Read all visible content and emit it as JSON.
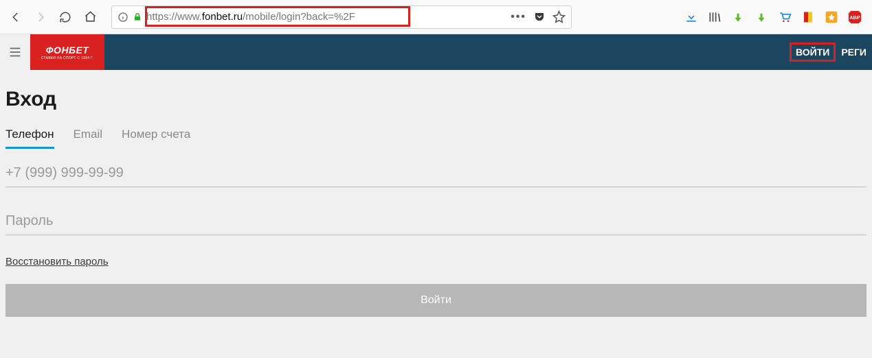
{
  "browser": {
    "url_prefix": "https://www.",
    "url_domain": "fonbet.ru",
    "url_path": "/mobile/login?back=%2F"
  },
  "header": {
    "logo": "ФОНБЕТ",
    "logo_sub": "СТАВКИ НА СПОРТ С 1994 Г.",
    "login": "ВОЙТИ",
    "register": "РЕГИ"
  },
  "page": {
    "title": "Вход",
    "tabs": {
      "phone": "Телефон",
      "email": "Email",
      "account": "Номер счета"
    },
    "phone_placeholder": "+7 (999) 999-99-99",
    "password_placeholder": "Пароль",
    "recover": "Восстановить пароль",
    "submit": "Войти"
  }
}
